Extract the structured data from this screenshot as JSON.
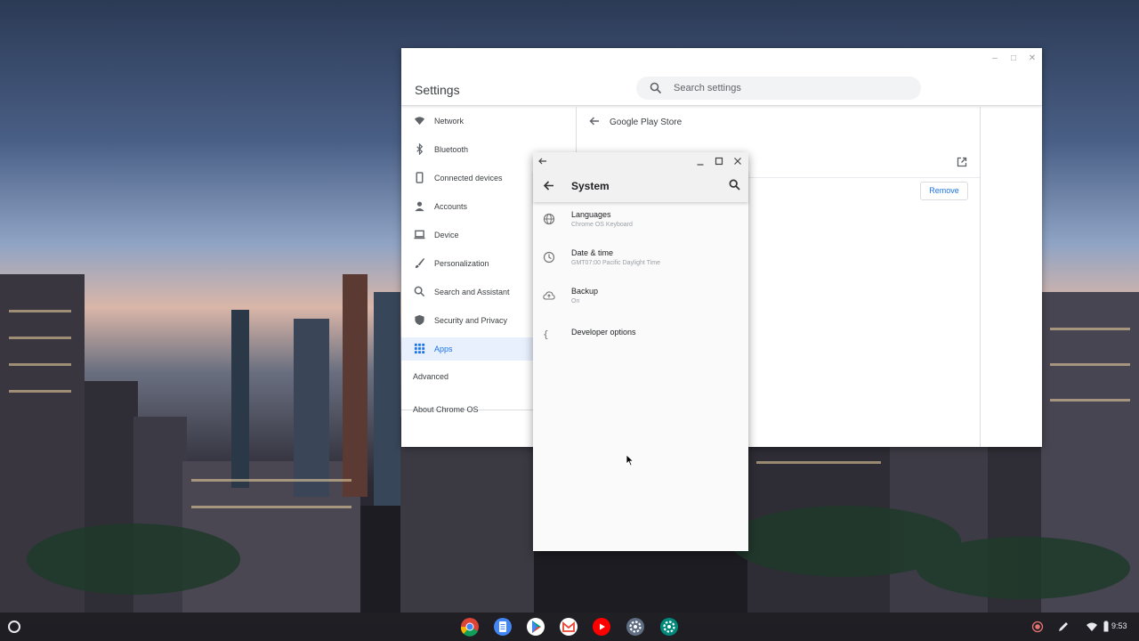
{
  "settings": {
    "title": "Settings",
    "search_placeholder": "Search settings",
    "nav": [
      {
        "label": "Network",
        "icon": "wifi-icon"
      },
      {
        "label": "Bluetooth",
        "icon": "bluetooth-icon"
      },
      {
        "label": "Connected devices",
        "icon": "phone-icon"
      },
      {
        "label": "Accounts",
        "icon": "person-icon"
      },
      {
        "label": "Device",
        "icon": "laptop-icon"
      },
      {
        "label": "Personalization",
        "icon": "brush-icon"
      },
      {
        "label": "Search and Assistant",
        "icon": "search-icon"
      },
      {
        "label": "Security and Privacy",
        "icon": "shield-icon"
      },
      {
        "label": "Apps",
        "icon": "apps-grid-icon"
      }
    ],
    "advanced_label": "Advanced",
    "about_label": "About Chrome OS",
    "page_title": "Google Play Store",
    "remove_label": "Remove",
    "accent": "#1a73e8"
  },
  "android": {
    "title": "System",
    "items": [
      {
        "title": "Languages",
        "subtitle": "Chrome OS Keyboard",
        "icon": "globe-icon"
      },
      {
        "title": "Date & time",
        "subtitle": "GMT07:00 Pacific Daylight Time",
        "icon": "clock-icon"
      },
      {
        "title": "Backup",
        "subtitle": "On",
        "icon": "cloud-backup-icon"
      },
      {
        "title": "Developer options",
        "subtitle": "",
        "icon": "braces-icon"
      }
    ]
  },
  "shelf": {
    "apps": [
      "chrome-icon",
      "docs-icon",
      "play-store-icon",
      "gmail-icon",
      "youtube-icon",
      "settings-icon",
      "android-settings-icon"
    ],
    "time": "9:53"
  }
}
